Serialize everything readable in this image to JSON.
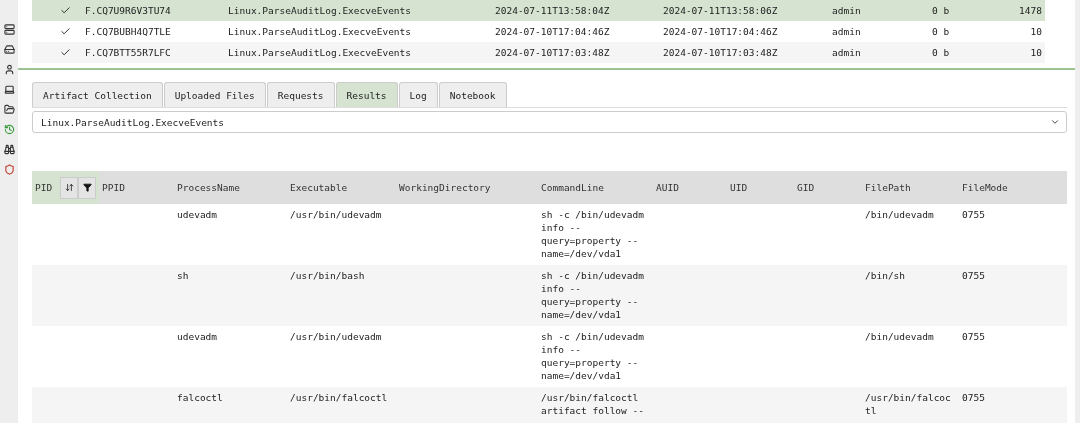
{
  "sidebar": {
    "items": [
      {
        "selected": false
      },
      {
        "selected": false
      },
      {
        "selected": false
      },
      {
        "selected": false
      },
      {
        "selected": false
      },
      {
        "selected": true
      },
      {
        "selected": false
      },
      {
        "selected": false
      }
    ]
  },
  "flows": [
    {
      "completed": true,
      "selected": true,
      "cells": [
        "F.CQ7U9R6V3TU74",
        "Linux.ParseAuditLog.ExecveEvents",
        "2024-07-11T13:58:04Z",
        "2024-07-11T13:58:06Z",
        "admin",
        "0 b",
        "1478"
      ]
    },
    {
      "completed": true,
      "selected": false,
      "cells": [
        "F.CQ7BUBH4Q7TLE",
        "Linux.ParseAuditLog.ExecveEvents",
        "2024-07-10T17:04:46Z",
        "2024-07-10T17:04:46Z",
        "admin",
        "0 b",
        "10"
      ]
    },
    {
      "completed": true,
      "selected": false,
      "cells": [
        "F.CQ7BTT55R7LFC",
        "Linux.ParseAuditLog.ExecveEvents",
        "2024-07-10T17:03:48Z",
        "2024-07-10T17:03:48Z",
        "admin",
        "0 b",
        "10"
      ]
    }
  ],
  "tabs": [
    {
      "label": "Artifact Collection",
      "selected": false
    },
    {
      "label": "Uploaded Files",
      "selected": false
    },
    {
      "label": "Requests",
      "selected": false
    },
    {
      "label": "Results",
      "selected": true
    },
    {
      "label": "Log",
      "selected": false
    },
    {
      "label": "Notebook",
      "selected": false
    }
  ],
  "artifact_select": {
    "value": "Linux.ParseAuditLog.ExecveEvents"
  },
  "results": {
    "columns": [
      {
        "label": "PID",
        "selected": true
      },
      {
        "label": "PPID",
        "selected": false
      },
      {
        "label": "ProcessName",
        "selected": false
      },
      {
        "label": "Executable",
        "selected": false
      },
      {
        "label": "WorkingDirectory",
        "selected": false
      },
      {
        "label": "CommandLine",
        "selected": false
      },
      {
        "label": "AUID",
        "selected": false
      },
      {
        "label": "UID",
        "selected": false
      },
      {
        "label": "GID",
        "selected": false
      },
      {
        "label": "FilePath",
        "selected": false
      },
      {
        "label": "FileMode",
        "selected": false
      }
    ],
    "rows": [
      [
        "",
        "",
        "udevadm",
        "/usr/bin/udevadm",
        "",
        "sh -c /bin/udevadm info --query=property --name=/dev/vda1",
        "",
        "",
        "",
        "/bin/udevadm",
        "0755"
      ],
      [
        "",
        "",
        "sh",
        "/usr/bin/bash",
        "",
        "sh -c /bin/udevadm info --query=property --name=/dev/vda1",
        "",
        "",
        "",
        "/bin/sh",
        "0755"
      ],
      [
        "",
        "",
        "udevadm",
        "/usr/bin/udevadm",
        "",
        "sh -c /bin/udevadm info --query=property --name=/dev/vda1",
        "",
        "",
        "",
        "/bin/udevadm",
        "0755"
      ],
      [
        "",
        "",
        "falcoctl",
        "/usr/bin/falcoctl",
        "",
        "/usr/bin/falcoctl artifact follow --",
        "",
        "",
        "",
        "/usr/bin/falcoctl",
        "0755"
      ]
    ]
  }
}
